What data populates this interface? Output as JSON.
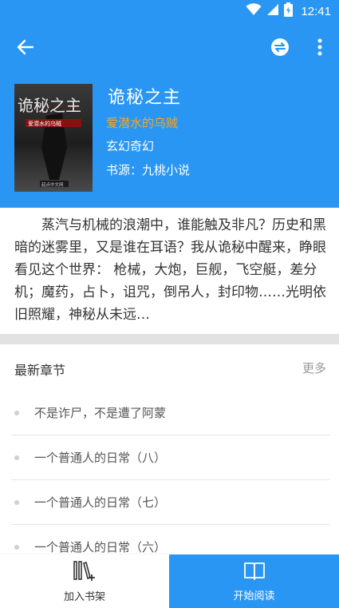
{
  "status_bar": {
    "time": "12:41",
    "icons": [
      "wifi-icon",
      "cell-signal-icon",
      "battery-icon"
    ]
  },
  "toolbar": {
    "icons": [
      "back-arrow-icon",
      "swap-source-icon",
      "more-vert-icon"
    ]
  },
  "book": {
    "title": "诡秘之主",
    "author": "爱潜水的乌贼",
    "category": "玄幻奇幻",
    "source": "书源：九桃小说",
    "cover": {
      "title_art": "诡秘之主",
      "author_art": "爱潜水的乌贼",
      "publisher_art": "起点中文网"
    },
    "description": "蒸汽与机械的浪潮中，谁能触及非凡？历史和黑暗的迷雾里，又是谁在耳语？我从诡秘中醒来，睁眼看见这个世界： 枪械，大炮，巨舰，飞空艇，差分机；魔药，占卜，诅咒，倒吊人，封印物……光明依旧照耀，神秘从未远…"
  },
  "latest_chapters": {
    "title": "最新章节",
    "more_label": "更多",
    "items": [
      "不是诈尸，不是遭了阿蒙",
      "一个普通人的日常（八）",
      "一个普通人的日常（七）",
      "一个普通人的日常（六）"
    ]
  },
  "bottom_bar": {
    "add_shelf_label": "加入书架",
    "start_read_label": "开始阅读"
  },
  "colors": {
    "primary": "#2a96f3",
    "author": "#f5a623",
    "divider": "#e2e2e2"
  }
}
